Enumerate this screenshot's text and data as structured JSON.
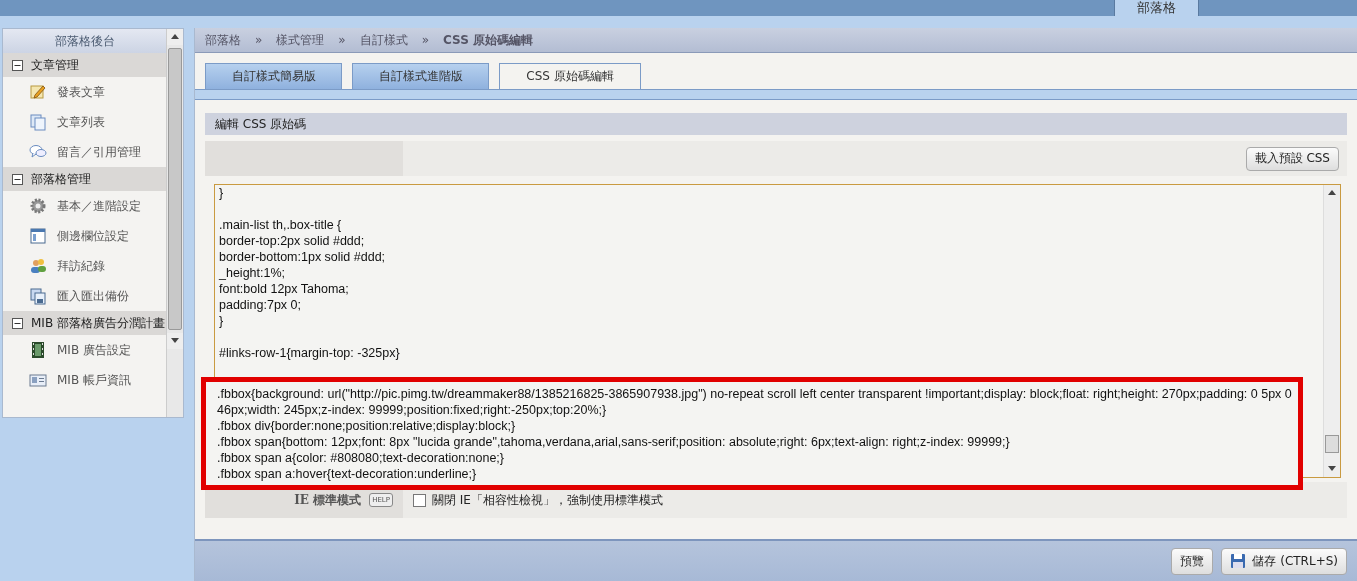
{
  "top_nav": {
    "items": [
      {
        "label": "部落格",
        "selected": true
      }
    ]
  },
  "sidebar": {
    "title": "部落格後台",
    "sections": [
      {
        "title": "文章管理",
        "expanded": true,
        "items": [
          {
            "label": "發表文章"
          },
          {
            "label": "文章列表"
          },
          {
            "label": "留言／引用管理"
          }
        ]
      },
      {
        "title": "部落格管理",
        "expanded": true,
        "items": [
          {
            "label": "基本／進階設定"
          },
          {
            "label": "側邊欄位設定"
          },
          {
            "label": "拜訪紀錄"
          },
          {
            "label": "匯入匯出備份"
          }
        ]
      },
      {
        "title": "MIB 部落格廣告分潤計畫",
        "expanded": true,
        "items": [
          {
            "label": "MIB 廣告設定"
          },
          {
            "label": "MIB 帳戶資訊"
          }
        ]
      }
    ]
  },
  "breadcrumb": {
    "separator": "»",
    "items": [
      "部落格",
      "樣式管理",
      "自訂樣式",
      "CSS 原始碼編輯"
    ]
  },
  "tabs": [
    {
      "label": "自訂樣式簡易版",
      "selected": false
    },
    {
      "label": "自訂樣式進階版",
      "selected": false
    },
    {
      "label": "CSS 原始碼編輯",
      "selected": true
    }
  ],
  "section_title": "編輯 CSS 原始碼",
  "load_default_button": "載入預設 CSS",
  "editor": {
    "blocks": [
      {
        "highlighted": false,
        "lines": [
          "}"
        ]
      },
      {
        "highlighted": false,
        "lines": [
          ".main-list th,.box-title {",
          "border-top:2px solid #ddd;",
          "border-bottom:1px solid #ddd;",
          "_height:1%;",
          "font:bold 12px Tahoma;",
          "padding:7px 0;",
          "}"
        ]
      },
      {
        "highlighted": false,
        "lines": [
          "#links-row-1{margin-top: -325px}"
        ]
      },
      {
        "highlighted": true,
        "lines": [
          ".fbbox{background: url(\"http://pic.pimg.tw/dreammaker88/1385216825-3865907938.jpg\") no-repeat scroll left center transparent !important;display: block;float: right;height: 270px;padding: 0 5px 0 46px;width: 245px;z-index: 99999;position:fixed;right:-250px;top:20%;}",
          ".fbbox div{border:none;position:relative;display:block;}",
          ".fbbox span{bottom: 12px;font: 8px \"lucida grande\",tahoma,verdana,arial,sans-serif;position: absolute;right: 6px;text-align: right;z-index: 99999;}",
          ".fbbox span a{color: #808080;text-decoration:none;}",
          ".fbbox span a:hover{text-decoration:underline;}"
        ]
      }
    ]
  },
  "ie_mode": {
    "label": "IE 標準模式",
    "help": "HELP",
    "checkbox": {
      "checked": false,
      "label": "關閉 IE「相容性檢視」，強制使用標準模式"
    }
  },
  "footer": {
    "preview_button": "預覽",
    "save_button": "儲存 (CTRL+S)"
  }
}
